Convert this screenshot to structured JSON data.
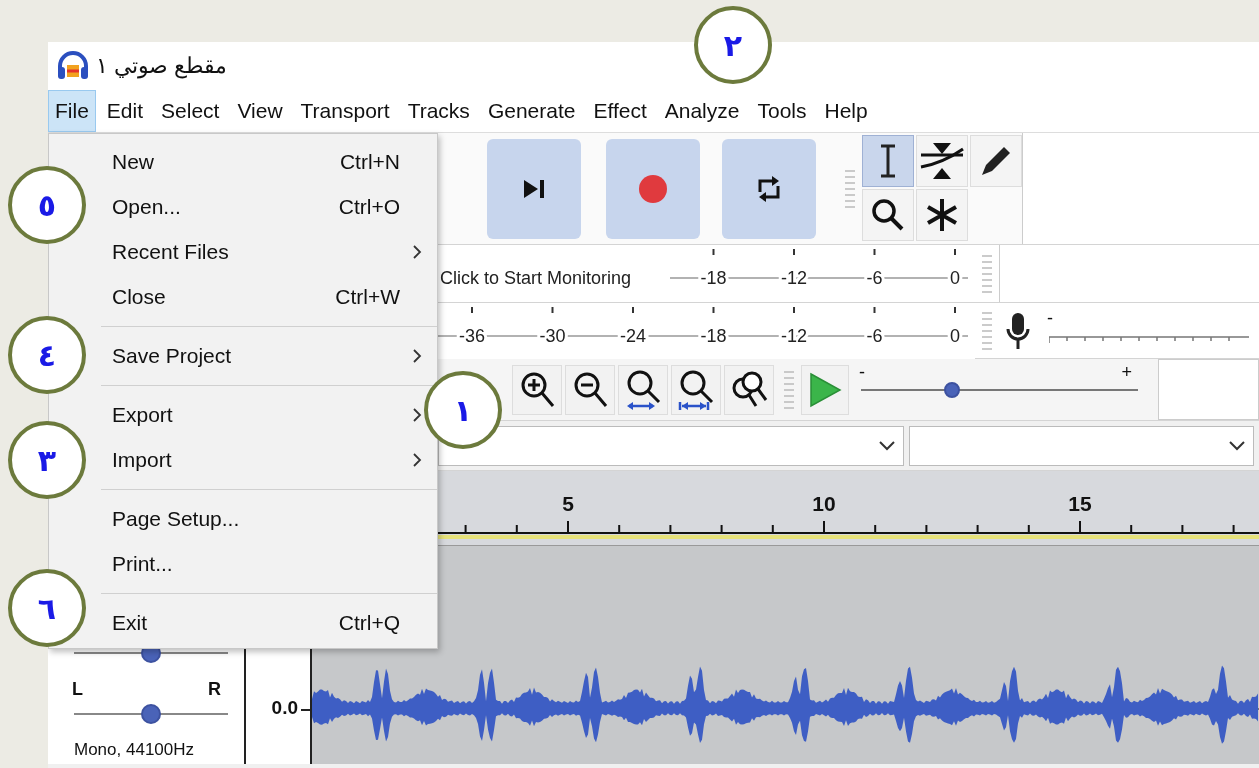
{
  "window": {
    "title": "مقطع صوتي ١"
  },
  "menu_bar": [
    {
      "label": "File",
      "selected": true
    },
    {
      "label": "Edit",
      "selected": false
    },
    {
      "label": "Select",
      "selected": false
    },
    {
      "label": "View",
      "selected": false
    },
    {
      "label": "Transport",
      "selected": false
    },
    {
      "label": "Tracks",
      "selected": false
    },
    {
      "label": "Generate",
      "selected": false
    },
    {
      "label": "Effect",
      "selected": false
    },
    {
      "label": "Analyze",
      "selected": false
    },
    {
      "label": "Tools",
      "selected": false
    },
    {
      "label": "Help",
      "selected": false
    }
  ],
  "file_menu": {
    "items": [
      {
        "kind": "item",
        "label": "New",
        "shortcut": "Ctrl+N"
      },
      {
        "kind": "item",
        "label": "Open...",
        "shortcut": "Ctrl+O"
      },
      {
        "kind": "submenu",
        "label": "Recent Files"
      },
      {
        "kind": "item",
        "label": "Close",
        "shortcut": "Ctrl+W"
      },
      {
        "kind": "separator"
      },
      {
        "kind": "submenu",
        "label": "Save Project"
      },
      {
        "kind": "separator"
      },
      {
        "kind": "submenu",
        "label": "Export"
      },
      {
        "kind": "submenu",
        "label": "Import"
      },
      {
        "kind": "separator"
      },
      {
        "kind": "item",
        "label": "Page Setup..."
      },
      {
        "kind": "item",
        "label": "Print..."
      },
      {
        "kind": "separator"
      },
      {
        "kind": "item",
        "label": "Exit",
        "shortcut": "Ctrl+Q"
      }
    ]
  },
  "transport_buttons": [
    {
      "kind": "skip-end"
    },
    {
      "kind": "record"
    },
    {
      "kind": "loop"
    }
  ],
  "tools": [
    {
      "kind": "selection",
      "selected": true
    },
    {
      "kind": "envelope",
      "selected": false
    },
    {
      "kind": "draw",
      "selected": false
    },
    {
      "kind": "zoom",
      "selected": false
    },
    {
      "kind": "multi",
      "selected": false
    }
  ],
  "recording_meter": {
    "hint": "Click to Start Monitoring",
    "ticks": [
      "-18",
      "-12",
      "-6",
      "0"
    ]
  },
  "playback_meter": {
    "ticks": [
      "-36",
      "-30",
      "-24",
      "-18",
      "-12",
      "-6",
      "0"
    ]
  },
  "recording_volume": {
    "min_label": "-"
  },
  "zoom_buttons": [
    {
      "kind": "zoom-in"
    },
    {
      "kind": "zoom-out"
    },
    {
      "kind": "fit-selection"
    },
    {
      "kind": "fit-project"
    },
    {
      "kind": "zoom-toggle"
    }
  ],
  "play_at_speed": {
    "min_label": "-",
    "max_label": "+",
    "level": 0.33
  },
  "ruler": {
    "labels": [
      "5",
      "10",
      "15"
    ]
  },
  "track": {
    "gain": {
      "level": 0.5
    },
    "pan": {
      "left_label": "L",
      "right_label": "R",
      "level": 0.5
    },
    "info": "Mono, 44100Hz",
    "scale": [
      "0.0"
    ]
  },
  "callouts": [
    {
      "label": "٢"
    },
    {
      "label": "٥"
    },
    {
      "label": "٤"
    },
    {
      "label": "١"
    },
    {
      "label": "٣"
    },
    {
      "label": "٦"
    }
  ]
}
